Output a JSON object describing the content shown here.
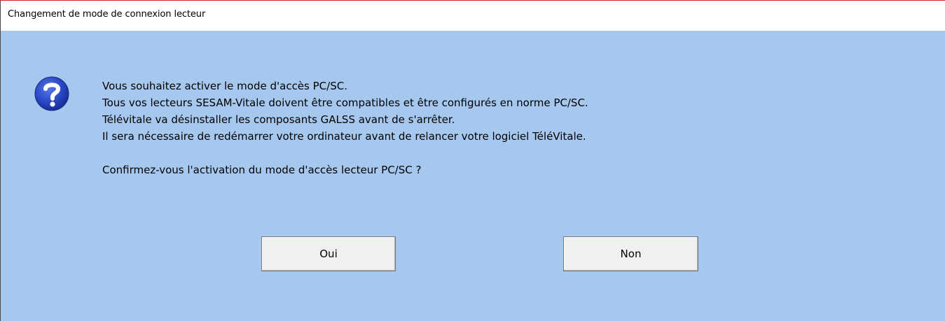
{
  "window": {
    "title": "Changement de mode de connexion lecteur",
    "background_color": "#a6c8ee"
  },
  "dialog": {
    "icon": "question-icon",
    "lines": [
      "Vous souhaitez activer le mode d'accès PC/SC.",
      "Tous vos lecteurs SESAM-Vitale doivent être compatibles et être configurés en norme PC/SC.",
      "Télévitale va désinstaller les composants GALSS avant de s'arrêter.",
      "Il sera nécessaire de redémarrer votre ordinateur avant de relancer votre logiciel TéléVitale."
    ],
    "question": "Confirmez-vous l'activation du mode d'accès lecteur PC/SC ?"
  },
  "buttons": {
    "yes_label": "Oui",
    "no_label": "Non"
  }
}
